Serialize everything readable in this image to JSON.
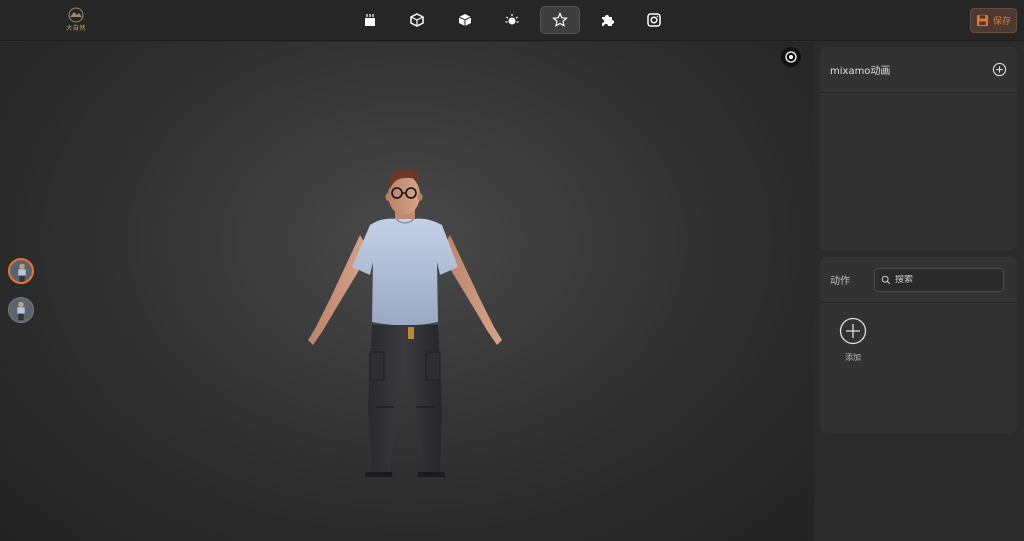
{
  "header": {
    "logo_text": "大自然",
    "save_label": "保存",
    "tools": [
      {
        "icon": "body-icon",
        "active": false
      },
      {
        "icon": "box-outline-icon",
        "active": false
      },
      {
        "icon": "box-solid-icon",
        "active": false
      },
      {
        "icon": "light-icon",
        "active": false
      },
      {
        "icon": "star-icon",
        "active": true
      },
      {
        "icon": "puzzle-icon",
        "active": false
      },
      {
        "icon": "camera-icon",
        "active": false
      }
    ]
  },
  "mixamo_panel": {
    "title": "mixamo动画"
  },
  "action_panel": {
    "title": "动作",
    "search_placeholder": "搜索",
    "add_label": "添加"
  },
  "colors": {
    "accent": "#e9762b",
    "background": "#2b2b2b",
    "panel": "#323232"
  }
}
